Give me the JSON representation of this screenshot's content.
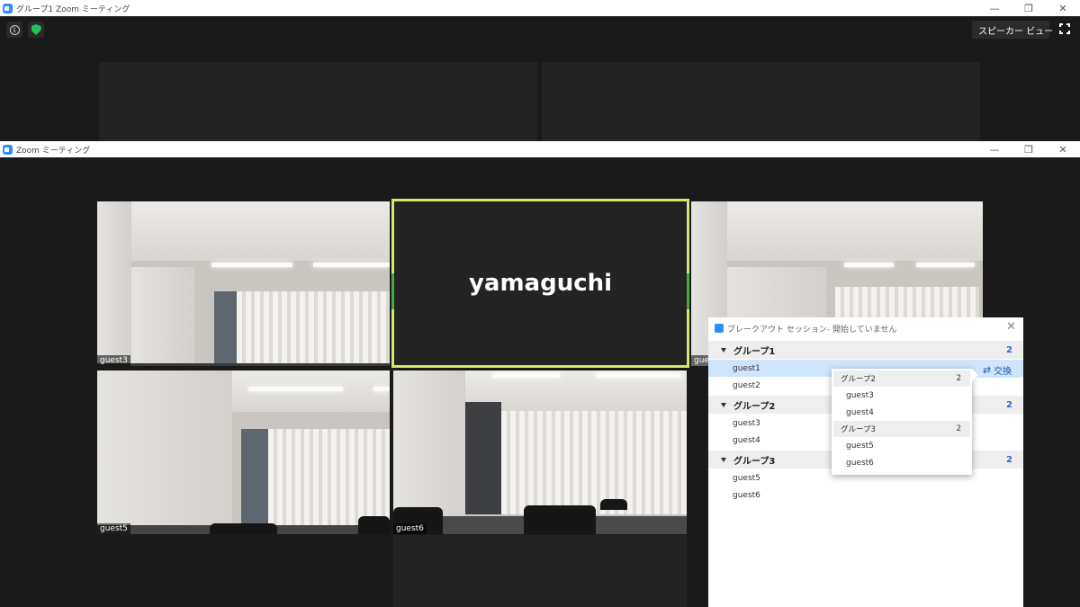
{
  "back_window": {
    "title": "グループ1  Zoom ミーティング",
    "view_button_label": "スピーカー ビュー"
  },
  "front_window": {
    "title": "Zoom ミーティング"
  },
  "window_controls": {
    "minimize": "—",
    "maximize": "❐",
    "close": "✕"
  },
  "video_tiles": [
    {
      "name": "guest3"
    },
    {
      "name": "yamaguchi"
    },
    {
      "name": "gue"
    },
    {
      "name": "guest5"
    },
    {
      "name": "guest6"
    }
  ],
  "breakout_panel": {
    "title": "ブレークアウト セッション- 開始していません",
    "close": "✕",
    "swap_label": "交換",
    "groups": [
      {
        "name": "グループ1",
        "count": "2",
        "members": [
          "guest1",
          "guest2"
        ]
      },
      {
        "name": "グループ2",
        "count": "2",
        "members": [
          "guest3",
          "guest4"
        ]
      },
      {
        "name": "グループ3",
        "count": "2",
        "members": [
          "guest5",
          "guest6"
        ]
      }
    ]
  },
  "swap_popup": {
    "groups": [
      {
        "name": "グループ2",
        "count": "2",
        "members": [
          "guest3",
          "guest4"
        ]
      },
      {
        "name": "グループ3",
        "count": "2",
        "members": [
          "guest5",
          "guest6"
        ]
      }
    ]
  },
  "colors": {
    "active_speaker_border": "#d3e86a",
    "group_count": "#2d6bcf",
    "selected_row": "#cfe5fb",
    "zoom_blue": "#2d8cff"
  }
}
